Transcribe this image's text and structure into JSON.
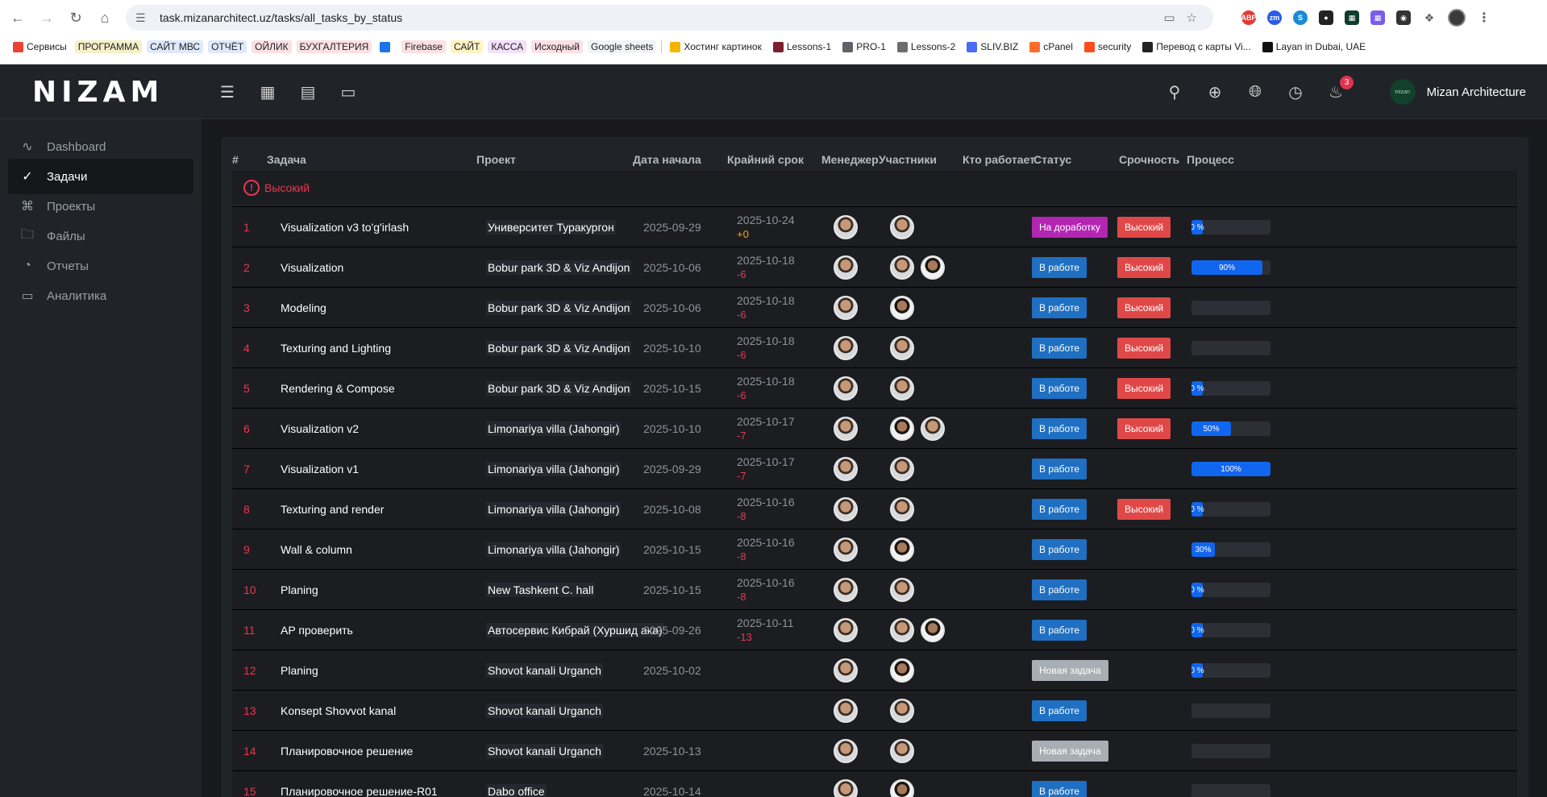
{
  "browser": {
    "url": "task.mizanarchitect.uz/tasks/all_tasks_by_status",
    "bookmarks": [
      {
        "label": "Сервисы",
        "color": "#ea4335"
      },
      {
        "label": "ПРОГРАММА",
        "color": "#f5f0c8"
      },
      {
        "label": "САЙТ МВС",
        "color": "#dfe9fb"
      },
      {
        "label": "ОТЧЁТ",
        "color": "#dfe9fb"
      },
      {
        "label": "ОЙЛИК",
        "color": "#fbe0e6"
      },
      {
        "label": "БУХГАЛТЕРИЯ",
        "color": "#fbe0e6"
      },
      {
        "label": "",
        "color": "#1a73e8"
      },
      {
        "label": "Firebase",
        "color": "#fbe0e6"
      },
      {
        "label": "САЙТ",
        "color": "#fff3c4"
      },
      {
        "label": "КАССА",
        "color": "#f3e0fb"
      },
      {
        "label": "Исходный",
        "color": "#fbe0e6"
      },
      {
        "label": "Google sheets",
        "color": "#f1f3f4"
      },
      {
        "label": "Хостинг картинок",
        "color": "#f5b400"
      },
      {
        "label": "Lessons-1",
        "color": "#7a1f2e"
      },
      {
        "label": "PRO-1",
        "color": "#5f6368"
      },
      {
        "label": "Lessons-2",
        "color": "#6d6d6d"
      },
      {
        "label": "SLIV.BIZ",
        "color": "#4a6cf7"
      },
      {
        "label": "cPanel",
        "color": "#ff6c2c"
      },
      {
        "label": "security",
        "color": "#ff4c1c"
      },
      {
        "label": "Перевод с карты Vi...",
        "color": "#222222"
      },
      {
        "label": "Layan in Dubai, UAE",
        "color": "#111111"
      }
    ]
  },
  "app": {
    "logo": "NIZAM",
    "notifications_count": "3",
    "user_name": "Mizan Architecture",
    "user_avatar_text": "mizan"
  },
  "sidebar": {
    "items": [
      {
        "label": "Dashboard",
        "icon": "activity-icon"
      },
      {
        "label": "Задачи",
        "icon": "check-circle-icon",
        "active": true
      },
      {
        "label": "Проекты",
        "icon": "command-icon"
      },
      {
        "label": "Файлы",
        "icon": "folder-icon"
      },
      {
        "label": "Отчеты",
        "icon": "pie-chart-icon"
      },
      {
        "label": "Аналитика",
        "icon": "monitor-icon"
      }
    ]
  },
  "table": {
    "headers": {
      "num": "#",
      "task": "Задача",
      "project": "Проект",
      "start": "Дата начала",
      "deadline": "Крайний срок",
      "manager": "Менеджер",
      "participants": "Участники",
      "who_works": "Кто работает",
      "status": "Статус",
      "urgency": "Срочность",
      "process": "Процесс"
    },
    "group_label": "Высокий",
    "rows": [
      {
        "num": "1",
        "task": "Visualization v3 to'g'irlash",
        "project": "Университет Туракургон",
        "start": "2025-09-29",
        "deadline": "2025-10-24",
        "offset": "+0",
        "participants": 1,
        "status": "На доработку",
        "status_color": "purple",
        "urgency": "Высокий",
        "progress": 0
      },
      {
        "num": "2",
        "task": "Visualization",
        "project": "Bobur park 3D & Viz Andijon",
        "start": "2025-10-06",
        "deadline": "2025-10-18",
        "offset": "-6",
        "participants": 2,
        "status": "В работе",
        "status_color": "blue",
        "urgency": "Высокий",
        "progress": 90
      },
      {
        "num": "3",
        "task": "Modeling",
        "project": "Bobur park 3D & Viz Andijon",
        "start": "2025-10-06",
        "deadline": "2025-10-18",
        "offset": "-6",
        "participants": 1,
        "status": "В работе",
        "status_color": "blue",
        "urgency": "Высокий",
        "progress": null
      },
      {
        "num": "4",
        "task": "Texturing and Lighting",
        "project": "Bobur park 3D & Viz Andijon",
        "start": "2025-10-10",
        "deadline": "2025-10-18",
        "offset": "-6",
        "participants": 1,
        "status": "В работе",
        "status_color": "blue",
        "urgency": "Высокий",
        "progress": null
      },
      {
        "num": "5",
        "task": "Rendering & Compose",
        "project": "Bobur park 3D & Viz Andijon",
        "start": "2025-10-15",
        "deadline": "2025-10-18",
        "offset": "-6",
        "participants": 1,
        "status": "В работе",
        "status_color": "blue",
        "urgency": "Высокий",
        "progress": 0
      },
      {
        "num": "6",
        "task": "Visualization v2",
        "project": "Limonariya villa (Jahongir)",
        "start": "2025-10-10",
        "deadline": "2025-10-17",
        "offset": "-7",
        "participants": 2,
        "status": "В работе",
        "status_color": "blue",
        "urgency": "Высокий",
        "progress": 50
      },
      {
        "num": "7",
        "task": "Visualization v1",
        "project": "Limonariya villa (Jahongir)",
        "start": "2025-09-29",
        "deadline": "2025-10-17",
        "offset": "-7",
        "participants": 1,
        "status": "В работе",
        "status_color": "blue",
        "urgency": "",
        "progress": 100
      },
      {
        "num": "8",
        "task": "Texturing and render",
        "project": "Limonariya villa (Jahongir)",
        "start": "2025-10-08",
        "deadline": "2025-10-16",
        "offset": "-8",
        "participants": 1,
        "status": "В работе",
        "status_color": "blue",
        "urgency": "Высокий",
        "progress": 0
      },
      {
        "num": "9",
        "task": "Wall & column",
        "project": "Limonariya villa (Jahongir)",
        "start": "2025-10-15",
        "deadline": "2025-10-16",
        "offset": "-8",
        "participants": 1,
        "status": "В работе",
        "status_color": "blue",
        "urgency": "",
        "progress": 30
      },
      {
        "num": "10",
        "task": "Planing",
        "project": "New Tashkent C. hall",
        "start": "2025-10-15",
        "deadline": "2025-10-16",
        "offset": "-8",
        "participants": 1,
        "status": "В работе",
        "status_color": "blue",
        "urgency": "",
        "progress": 0
      },
      {
        "num": "11",
        "task": "AP проверить",
        "project": "Автосервис Кибрай (Хуршид ака)",
        "start": "2025-09-26",
        "deadline": "2025-10-11",
        "offset": "-13",
        "participants": 2,
        "status": "В работе",
        "status_color": "blue",
        "urgency": "",
        "progress": 0
      },
      {
        "num": "12",
        "task": "Planing",
        "project": "Shovot kanali Urganch",
        "start": "2025-10-02",
        "deadline": "",
        "offset": "",
        "participants": 1,
        "status": "Новая задача",
        "status_color": "gray",
        "urgency": "",
        "progress": 0
      },
      {
        "num": "13",
        "task": "Konsept Shovvot kanal",
        "project": "Shovot kanali Urganch",
        "start": "",
        "deadline": "",
        "offset": "",
        "participants": 1,
        "status": "В работе",
        "status_color": "blue",
        "urgency": "",
        "progress": null
      },
      {
        "num": "14",
        "task": "Планировочное решение",
        "project": "Shovot kanali Urganch",
        "start": "2025-10-13",
        "deadline": "",
        "offset": "",
        "participants": 1,
        "status": "Новая задача",
        "status_color": "gray",
        "urgency": "",
        "progress": null
      },
      {
        "num": "15",
        "task": "Планировочное решение-R01",
        "project": "Dabo office",
        "start": "2025-10-14",
        "deadline": "",
        "offset": "",
        "participants": 1,
        "status": "В работе",
        "status_color": "blue",
        "urgency": "",
        "progress": null
      }
    ]
  }
}
